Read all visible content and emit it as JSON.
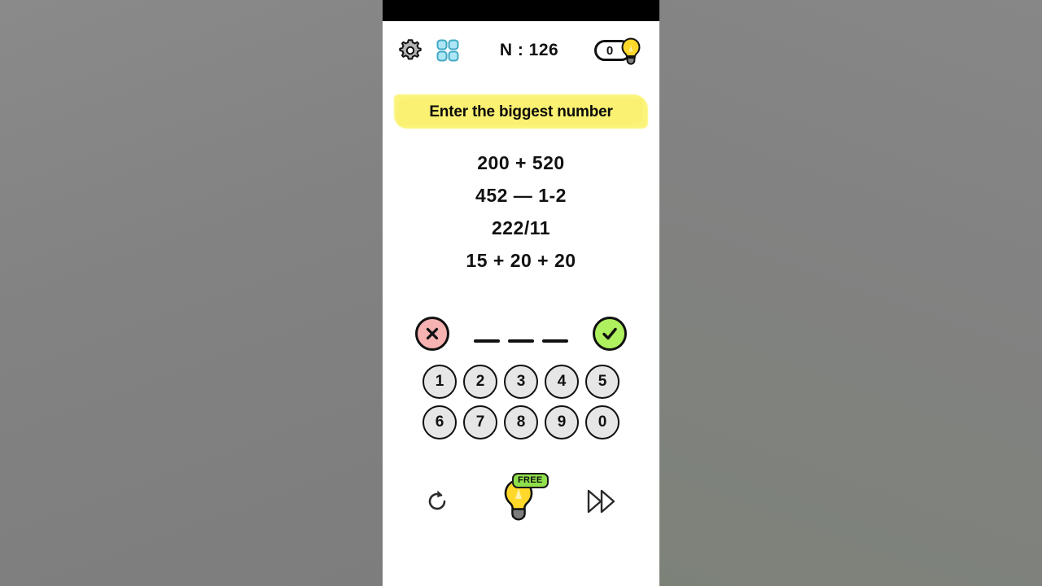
{
  "header": {
    "settings_icon": "gear-icon",
    "levels_icon": "grid-icon",
    "level_label": "N : 126",
    "hint_count": "0",
    "hint_icon": "lightbulb-icon"
  },
  "banner": {
    "text": "Enter the biggest number",
    "highlight_color": "#fbf474"
  },
  "expressions": [
    "200 + 520",
    "452  — 1-2",
    "222/11",
    "15 + 20 + 20"
  ],
  "answer": {
    "clear_icon": "close-icon",
    "submit_icon": "check-icon",
    "clear_color": "#f7b2b2",
    "submit_color": "#aef05e",
    "slots": [
      "",
      "",
      ""
    ]
  },
  "keypad": {
    "row1": [
      "1",
      "2",
      "3",
      "4",
      "5"
    ],
    "row2": [
      "6",
      "7",
      "8",
      "9",
      "0"
    ]
  },
  "toolbar": {
    "restart_icon": "restart-icon",
    "hint_icon": "lightbulb-icon",
    "hint_badge": "FREE",
    "skip_icon": "fast-forward-icon"
  },
  "colors": {
    "backdrop": "#828282",
    "phone_bg": "#ffffff",
    "status_bar": "#000000",
    "key_fill": "#e6e6e6",
    "bulb_yellow": "#ffd829",
    "grid_blue": "#aee6f5",
    "free_green": "#8fe04a"
  }
}
